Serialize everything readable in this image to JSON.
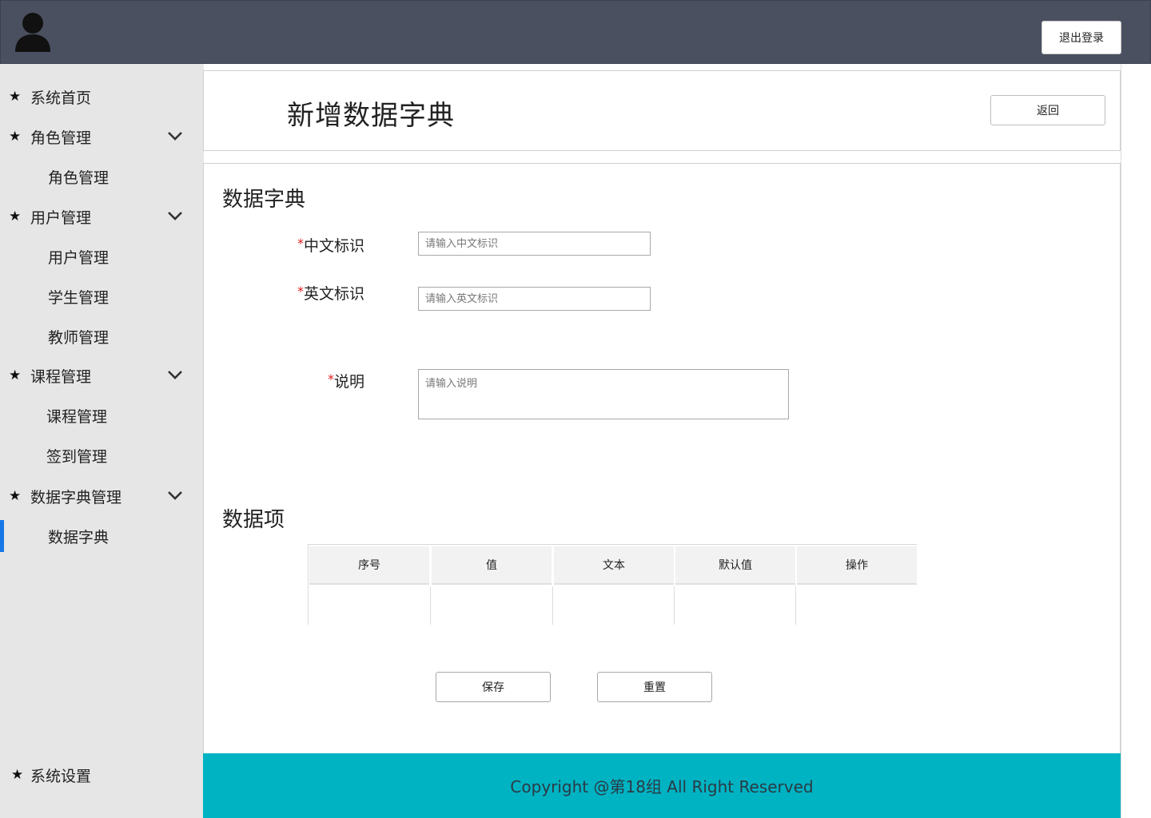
{
  "header": {
    "logout_label": "退出登录"
  },
  "sidebar": {
    "items": [
      {
        "label": "系统首页"
      },
      {
        "label": "角色管理",
        "children": [
          "角色管理"
        ]
      },
      {
        "label": "用户管理",
        "children": [
          "用户管理",
          "学生管理",
          "教师管理"
        ]
      },
      {
        "label": "课程管理",
        "children": [
          "课程管理",
          "签到管理"
        ]
      },
      {
        "label": "数据字典管理",
        "children": [
          "数据字典"
        ]
      }
    ],
    "bottom_item": "系统设置",
    "active_item": "数据字典"
  },
  "page": {
    "title": "新增数据字典",
    "back_label": "返回"
  },
  "form": {
    "section_title": "数据字典",
    "required_mark": "*",
    "fields": [
      {
        "label": "中文标识",
        "placeholder": "请输入中文标识"
      },
      {
        "label": "英文标识",
        "placeholder": "请输入英文标识"
      },
      {
        "label": "说明",
        "placeholder": "请输入说明"
      }
    ]
  },
  "items_section": {
    "title": "数据项",
    "columns": [
      "序号",
      "值",
      "文本",
      "默认值",
      "操作"
    ]
  },
  "actions": {
    "save_label": "保存",
    "reset_label": "重置"
  },
  "footer": {
    "text": "Copyright @第18组 All Right Reserved"
  },
  "colors": {
    "header_bg": "#4a5060",
    "sidebar_bg": "#e6e6e6",
    "footer_bg": "#00b3c3",
    "active_indicator": "#1677e6",
    "required": "#e02020"
  }
}
